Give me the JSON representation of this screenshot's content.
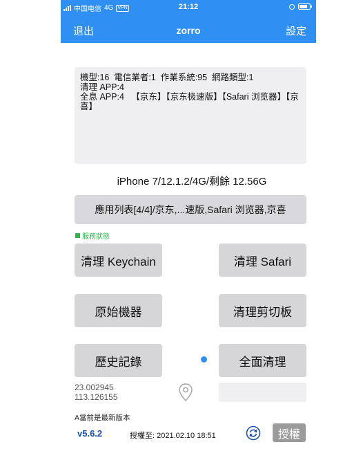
{
  "status_bar": {
    "carrier": "中国电信",
    "network": "4G",
    "vpn": "VPN",
    "time": "21:12"
  },
  "nav": {
    "back_label": "退出",
    "title": "zorro",
    "settings_label": "設定"
  },
  "info": {
    "lines": [
      "機型:16  電信業者:1  作業系統:95  網路類型:1",
      "清理 APP:4",
      "全息 APP:4   【京东】【京东极速版】【Safari 浏览器】【京喜】"
    ]
  },
  "device_info": "iPhone 7/12.1.2/4G/剩餘 12.56G",
  "app_list_label": "應用列表[4/4]/京东,...速版,Safari 浏览器,京喜",
  "service_status": "服務狀態",
  "buttons": {
    "clear_keychain": "清理 Keychain",
    "clear_safari": "清理 Safari",
    "original_device": "原始機器",
    "clear_clipboard": "清理剪切板",
    "history": "歷史記錄",
    "full_clean": "全面清理"
  },
  "location": {
    "lat": "23.002945",
    "lng": "113.126155"
  },
  "latest_version_text": "A當前是最新版本",
  "version": "v5.6.2",
  "auth_expiry": "授權至: 2021.02.10 18:51",
  "authorize_label": "授權",
  "colors": {
    "nav_blue": "#2f8ff3",
    "button_gray": "#d6d6d9",
    "service_green": "#2db84d",
    "version_blue": "#1e4fb0"
  }
}
